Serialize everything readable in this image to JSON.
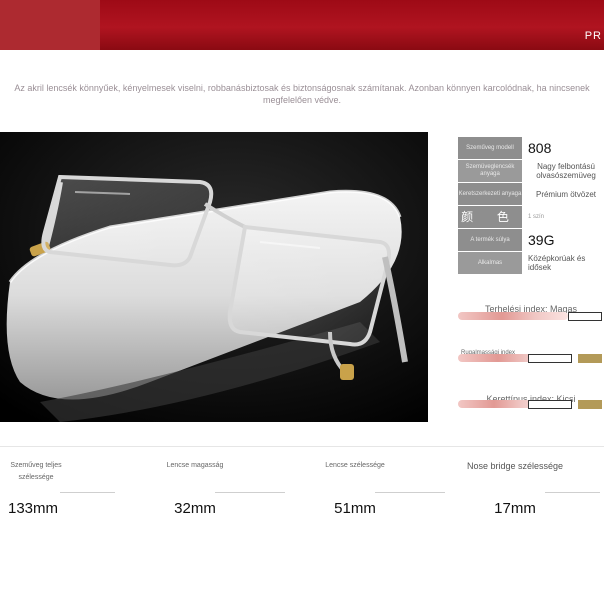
{
  "banner": {
    "brand": "PR"
  },
  "intro_text": "Az akril lencsék könnyűek, kényelmesek viselni, robbanásbiztosak és biztonságosnak számítanak. Azonban könnyen karcolódnak, ha nincsenek megfelelően védve.",
  "photo": {
    "subject": "reading-glasses-on-white-case"
  },
  "specs": [
    {
      "key": "Szeműveg modell",
      "value": "808"
    },
    {
      "key": "Szemüveglencsék anyaga",
      "value": "Nagy felbontású olvasószemüveg"
    },
    {
      "key": "Keretszerkezeti anyaga",
      "value": "Prémium ötvözet"
    },
    {
      "key": "颜 色",
      "value": "1 szín"
    },
    {
      "key": "A termék súlya",
      "value": "39G"
    },
    {
      "key": "Alkalmas",
      "value": "Középkorúak és idősek"
    }
  ],
  "indexes": [
    {
      "label": "Terhelési index: Magas",
      "level": "high"
    },
    {
      "label": "Rugalmassági index",
      "level": "high"
    },
    {
      "label": "Kerettípus index: Kicsi",
      "level": "high"
    }
  ],
  "dimensions": [
    {
      "label": "Szeműveg teljes szélessége",
      "value": "133mm"
    },
    {
      "label": "Lencse magasság",
      "value": "32mm"
    },
    {
      "label": "Lencse szélessége",
      "value": "51mm"
    },
    {
      "label": "Nose bridge szélessége",
      "value": "17mm"
    }
  ],
  "colors": {
    "banner": "#9e0a16",
    "marker": "#b39a58",
    "label_bg": "#8e8e8e"
  }
}
